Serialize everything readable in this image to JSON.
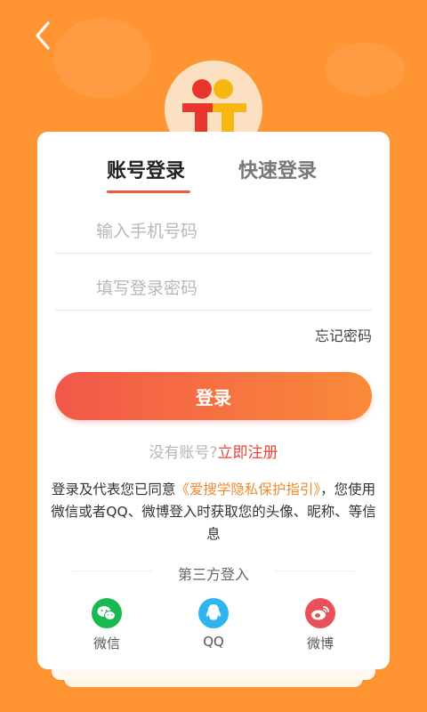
{
  "colors": {
    "background": "#ff9433",
    "accent": "#f05a3a",
    "gradient_start": "#f2574a",
    "gradient_end": "#fa8a3a",
    "policy_link": "#f08a30",
    "register_link": "#e8463a",
    "wechat": "#1ab850",
    "qq": "#2fb4f0",
    "weibo": "#e8515a"
  },
  "header": {
    "back_icon": "chevron-left-icon",
    "logo_icon": "two-people-logo-icon"
  },
  "tabs": [
    {
      "label": "账号登录",
      "active": true
    },
    {
      "label": "快速登录",
      "active": false
    }
  ],
  "form": {
    "phone_placeholder": "输入手机号码",
    "password_placeholder": "填写登录密码",
    "forgot_label": "忘记密码",
    "login_label": "登录"
  },
  "register": {
    "prompt": "没有账号?",
    "link": "立即注册"
  },
  "agreement": {
    "prefix": "登录及代表您已同意",
    "policy": "《爱搜学隐私保护指引》",
    "suffix": "，您使用微信或者QQ、微博登入时获取您的头像、昵称、等信息"
  },
  "third_party": {
    "title": "第三方登入",
    "items": [
      {
        "label": "微信",
        "icon": "wechat-icon"
      },
      {
        "label": "QQ",
        "icon": "qq-icon"
      },
      {
        "label": "微博",
        "icon": "weibo-icon"
      }
    ]
  }
}
